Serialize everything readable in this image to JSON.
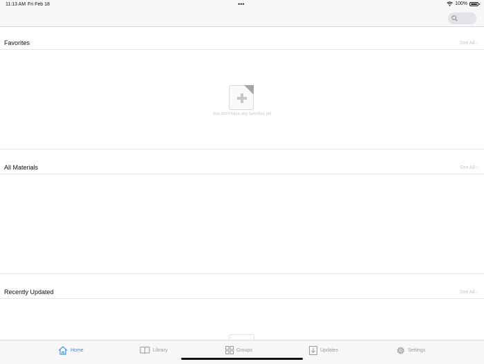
{
  "status_bar": {
    "time": "11:13 AM",
    "date": "Fri Feb 18",
    "battery": "100%"
  },
  "nav": {
    "search_icon": "search-icon"
  },
  "sections": {
    "favorites": {
      "title": "Favorites",
      "see_all": "See All ›",
      "empty_text": "You don't have any favorites yet"
    },
    "all_materials": {
      "title": "All Materials",
      "see_all": "See All ›"
    },
    "recently_updated": {
      "title": "Recently Updated",
      "see_all": "See All ›"
    }
  },
  "tabs": [
    {
      "label": "Home",
      "icon": "home-icon",
      "active": true
    },
    {
      "label": "Library",
      "icon": "book-icon",
      "active": false
    },
    {
      "label": "Groups",
      "icon": "grid-icon",
      "active": false
    },
    {
      "label": "Updates",
      "icon": "download-icon",
      "active": false
    },
    {
      "label": "Settings",
      "icon": "gear-icon",
      "active": false
    }
  ],
  "colors": {
    "accent": "#2f8cf0",
    "inactive": "#9a9a9a",
    "bar_background": "#f7f7f7"
  }
}
